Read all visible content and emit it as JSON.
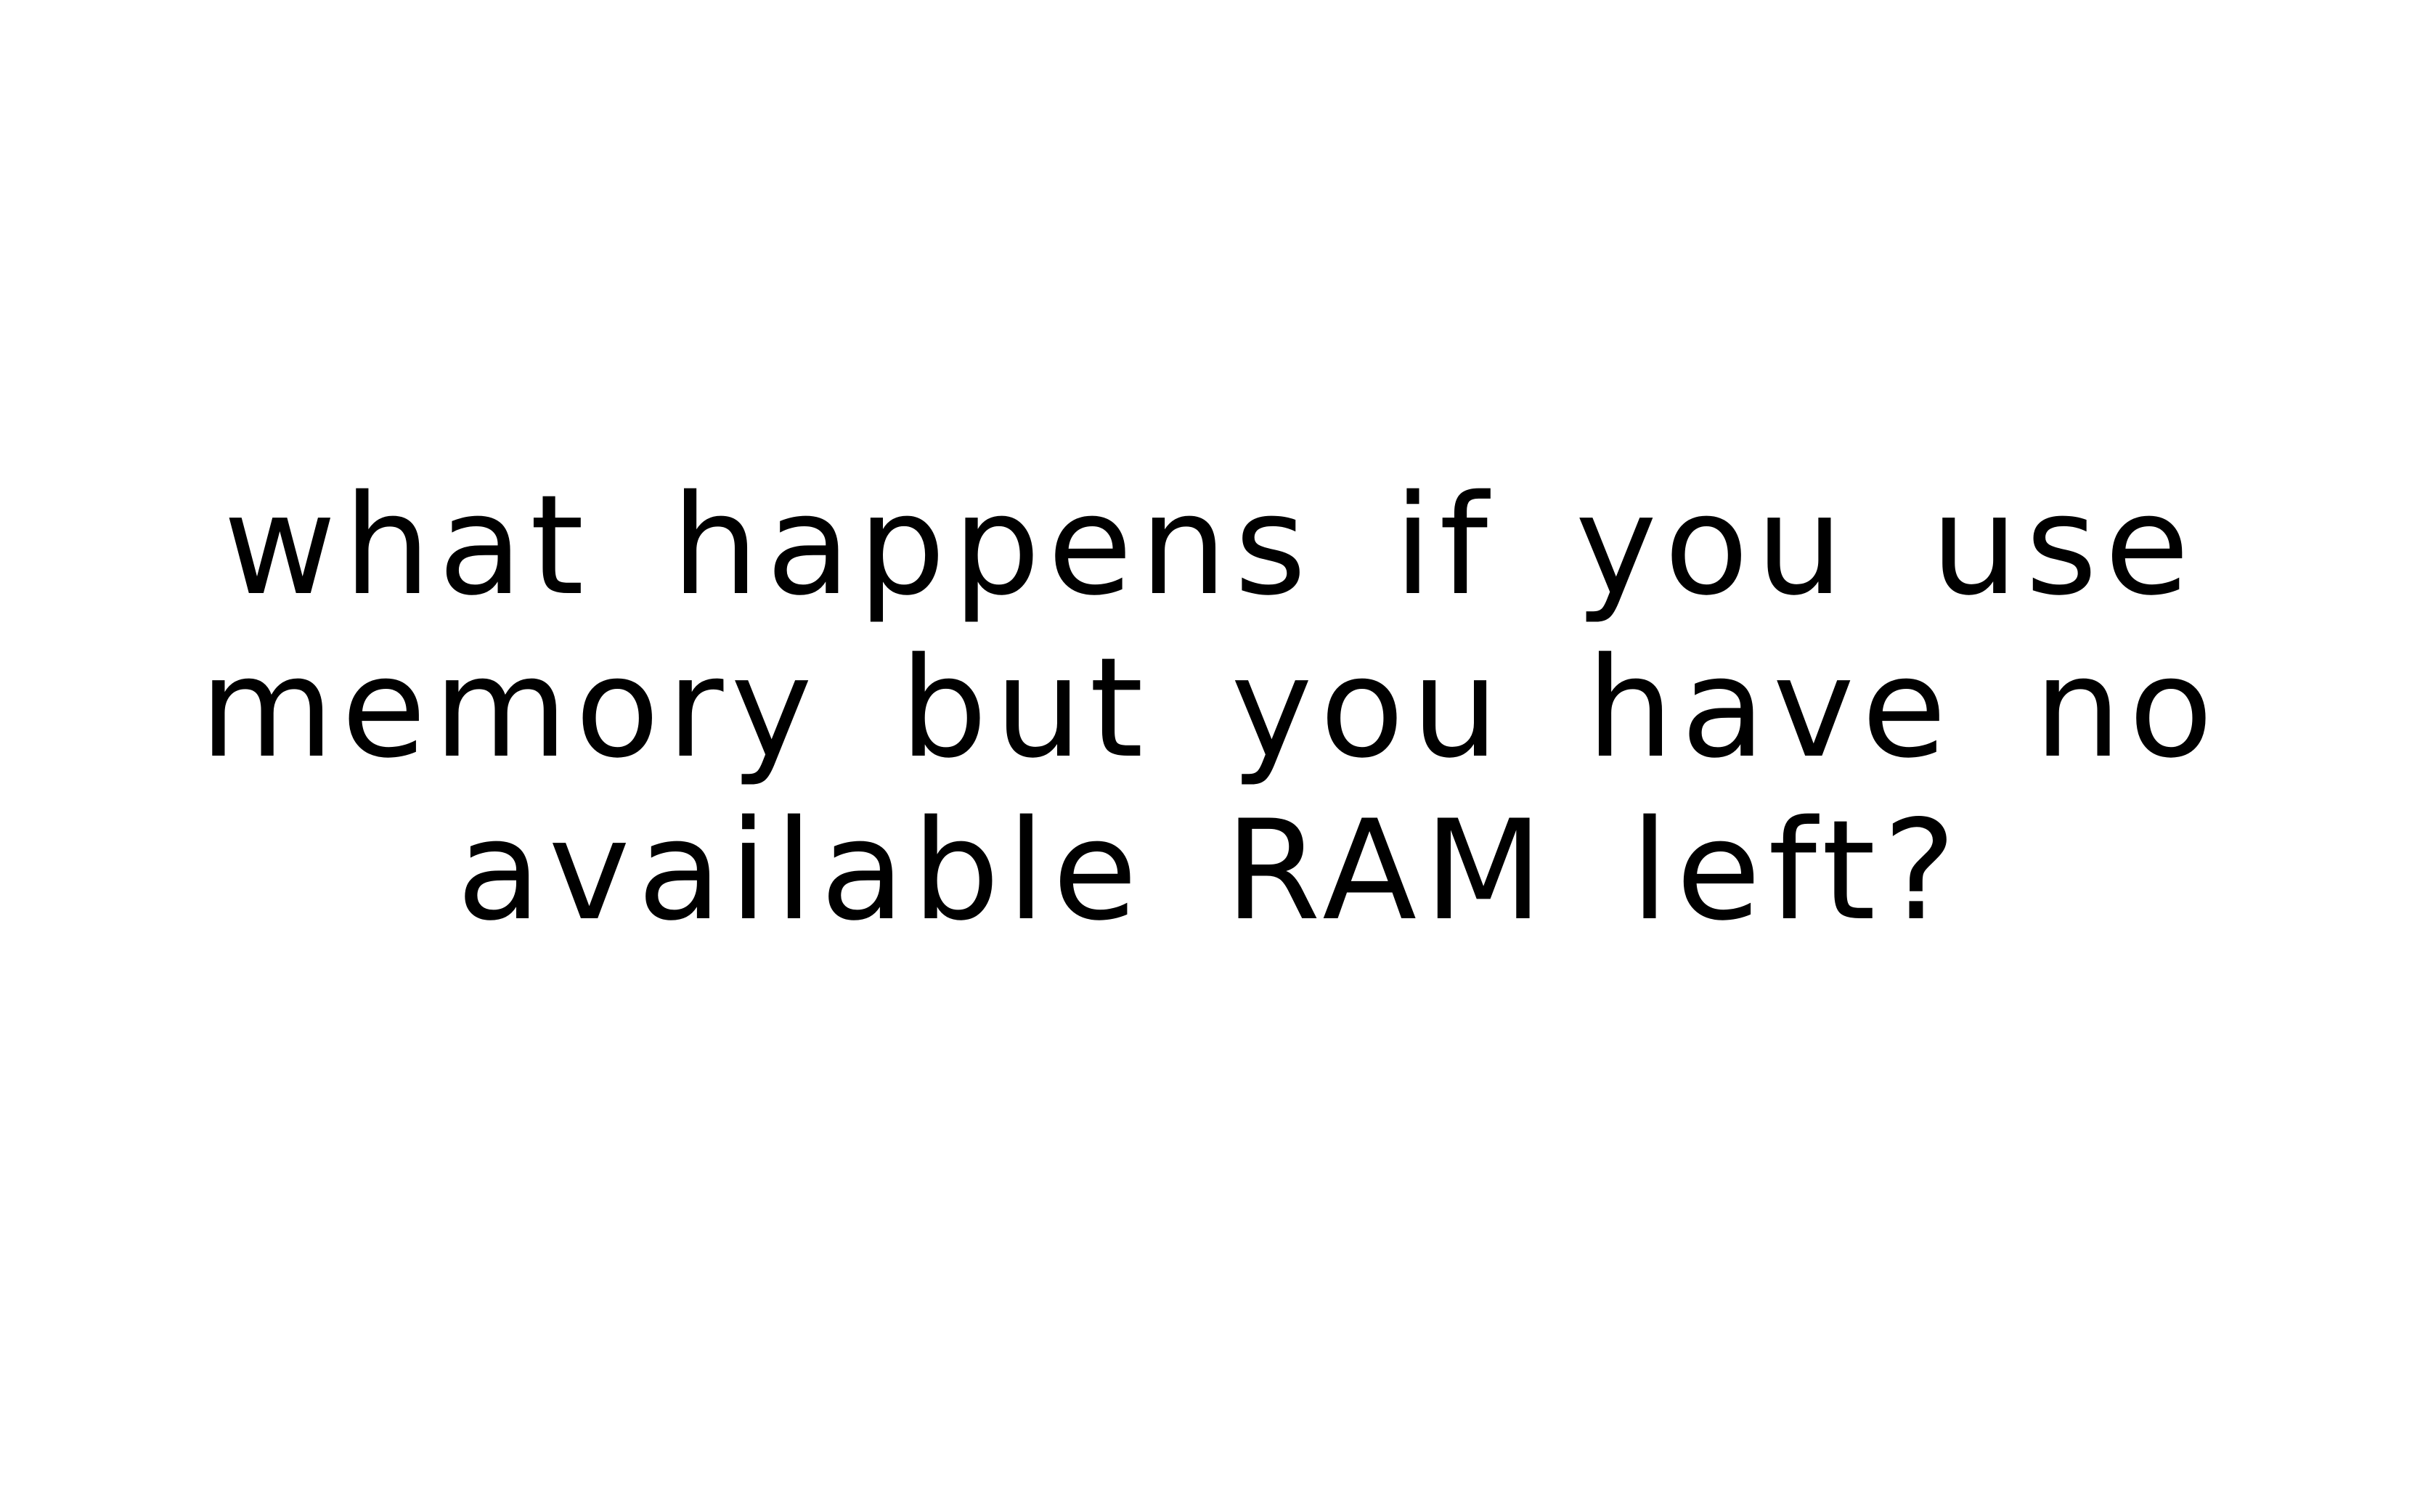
{
  "text": {
    "line1": "what happens if you use",
    "line2": "memory but you have no",
    "line3": "available RAM left?"
  },
  "colors": {
    "background": "#ffffff",
    "text": "#000000"
  }
}
